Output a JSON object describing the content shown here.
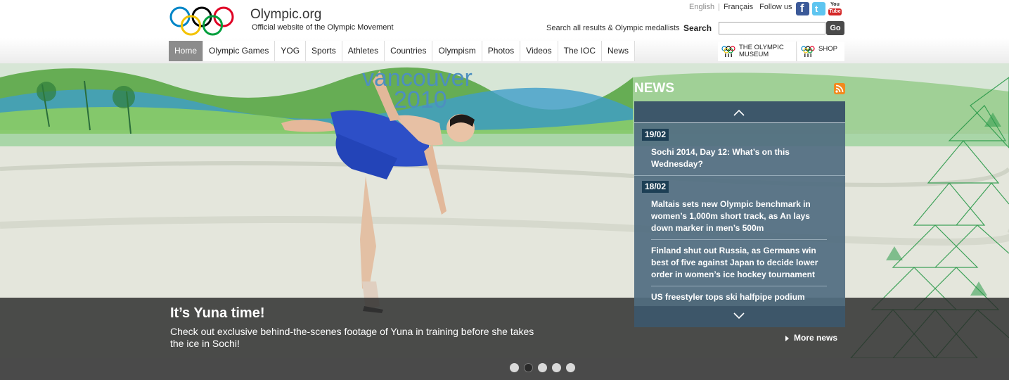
{
  "header": {
    "site_title": "Olympic.org",
    "site_subtitle": "Official website of the Olympic Movement",
    "lang_english": "English",
    "lang_separator": "|",
    "lang_french": "Français",
    "follow_us": "Follow us",
    "social": [
      {
        "name": "facebook-icon",
        "glyph": "f",
        "color": "#3b5998"
      },
      {
        "name": "twitter-icon",
        "glyph": "t",
        "color": "#5ec5f0"
      },
      {
        "name": "youtube-icon",
        "top": "You",
        "bottom": "Tube",
        "color": "#d42828"
      }
    ],
    "search_hint": "Search all results & Olympic medallists",
    "search_label": "Search",
    "search_value": "",
    "search_button": "Go"
  },
  "nav": {
    "items": [
      "Home",
      "Olympic Games",
      "YOG",
      "Sports",
      "Athletes",
      "Countries",
      "Olympism",
      "Photos",
      "Videos",
      "The IOC",
      "News"
    ],
    "active_index": 0
  },
  "shortcuts": {
    "museum_line1": "THE OLYMPIC",
    "museum_line2": "MUSEUM",
    "shop": "SHOP"
  },
  "hero": {
    "title": "It’s Yuna time!",
    "text": "Check out exclusive behind-the-scenes footage of Yuna in training before she takes the ice in Sochi!",
    "banner_text_1": "vancouver",
    "banner_text_2": "2010"
  },
  "news": {
    "heading": "NEWS",
    "groups": [
      {
        "date": "19/02",
        "items": [
          "Sochi 2014, Day 12: What’s on this Wednesday?"
        ]
      },
      {
        "date": "18/02",
        "items": [
          "Maltais sets new Olympic benchmark in women’s 1,000m short track, as An lays down marker in men’s 500m",
          "Finland shut out Russia, as Germans win best of five against Japan to decide lower order in women’s ice hockey tournament",
          "US freestyler tops ski halfpipe podium"
        ]
      }
    ],
    "more": "More news"
  },
  "carousel": {
    "slide_count": 5,
    "active_index": 1
  },
  "colors": {
    "ring_blue": "#0085c7",
    "ring_yellow": "#f4c300",
    "ring_black": "#000000",
    "ring_green": "#009f3d",
    "ring_red": "#df0024",
    "news_panel": "#506c80",
    "date_badge": "#1d3f55"
  }
}
